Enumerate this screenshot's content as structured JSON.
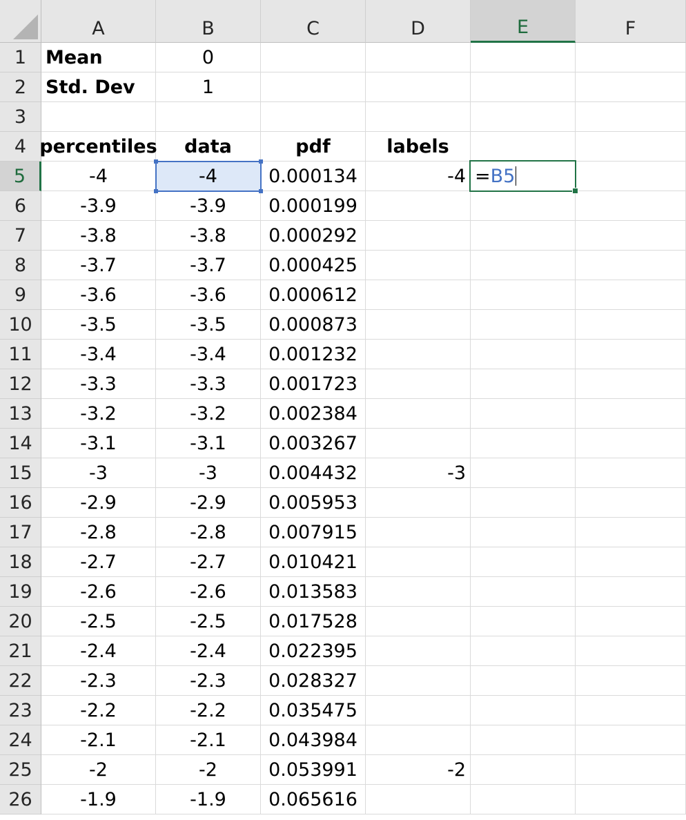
{
  "columns": [
    "A",
    "B",
    "C",
    "D",
    "E",
    "F"
  ],
  "rows": [
    "1",
    "2",
    "3",
    "4",
    "5",
    "6",
    "7",
    "8",
    "9",
    "10",
    "11",
    "12",
    "13",
    "14",
    "15",
    "16",
    "17",
    "18",
    "19",
    "20",
    "21",
    "22",
    "23",
    "24",
    "25",
    "26"
  ],
  "active_column": "E",
  "active_row": "5",
  "header_cells": {
    "mean_label": "Mean",
    "mean_value": "0",
    "std_label": "Std. Dev",
    "std_value": "1",
    "percentiles": "percentiles",
    "data": "data",
    "pdf": "pdf",
    "labels": "labels"
  },
  "table_rows": [
    {
      "a": "-4",
      "b": "-4",
      "c": "0.000134",
      "d": "-4"
    },
    {
      "a": "-3.9",
      "b": "-3.9",
      "c": "0.000199",
      "d": ""
    },
    {
      "a": "-3.8",
      "b": "-3.8",
      "c": "0.000292",
      "d": ""
    },
    {
      "a": "-3.7",
      "b": "-3.7",
      "c": "0.000425",
      "d": ""
    },
    {
      "a": "-3.6",
      "b": "-3.6",
      "c": "0.000612",
      "d": ""
    },
    {
      "a": "-3.5",
      "b": "-3.5",
      "c": "0.000873",
      "d": ""
    },
    {
      "a": "-3.4",
      "b": "-3.4",
      "c": "0.001232",
      "d": ""
    },
    {
      "a": "-3.3",
      "b": "-3.3",
      "c": "0.001723",
      "d": ""
    },
    {
      "a": "-3.2",
      "b": "-3.2",
      "c": "0.002384",
      "d": ""
    },
    {
      "a": "-3.1",
      "b": "-3.1",
      "c": "0.003267",
      "d": ""
    },
    {
      "a": "-3",
      "b": "-3",
      "c": "0.004432",
      "d": "-3"
    },
    {
      "a": "-2.9",
      "b": "-2.9",
      "c": "0.005953",
      "d": ""
    },
    {
      "a": "-2.8",
      "b": "-2.8",
      "c": "0.007915",
      "d": ""
    },
    {
      "a": "-2.7",
      "b": "-2.7",
      "c": "0.010421",
      "d": ""
    },
    {
      "a": "-2.6",
      "b": "-2.6",
      "c": "0.013583",
      "d": ""
    },
    {
      "a": "-2.5",
      "b": "-2.5",
      "c": "0.017528",
      "d": ""
    },
    {
      "a": "-2.4",
      "b": "-2.4",
      "c": "0.022395",
      "d": ""
    },
    {
      "a": "-2.3",
      "b": "-2.3",
      "c": "0.028327",
      "d": ""
    },
    {
      "a": "-2.2",
      "b": "-2.2",
      "c": "0.035475",
      "d": ""
    },
    {
      "a": "-2.1",
      "b": "-2.1",
      "c": "0.043984",
      "d": ""
    },
    {
      "a": "-2",
      "b": "-2",
      "c": "0.053991",
      "d": "-2"
    },
    {
      "a": "-1.9",
      "b": "-1.9",
      "c": "0.065616",
      "d": ""
    }
  ],
  "editing_cell": {
    "prefix": "=",
    "reference": "B5"
  },
  "colors": {
    "active_green": "#217346",
    "reference_blue": "#4472c4",
    "reference_fill": "#dde8f8"
  }
}
